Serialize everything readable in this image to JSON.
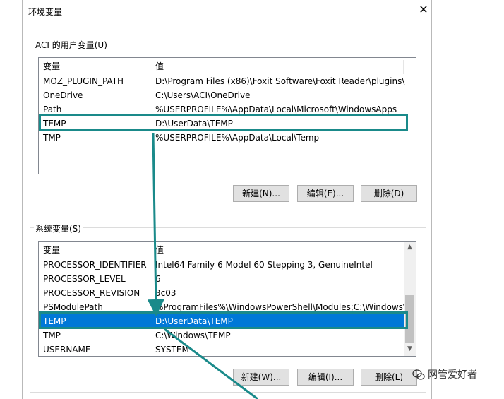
{
  "dialog": {
    "title": "环境变量",
    "close_symbol": "✕"
  },
  "user_vars": {
    "group_label": "ACI 的用户变量(U)",
    "col_variable": "变量",
    "col_value": "值",
    "rows": [
      {
        "name": "MOZ_PLUGIN_PATH",
        "value": "D:\\Program Files (x86)\\Foxit Software\\Foxit Reader\\plugins\\"
      },
      {
        "name": "OneDrive",
        "value": "C:\\Users\\ACI\\OneDrive"
      },
      {
        "name": "Path",
        "value": "%USERPROFILE%\\AppData\\Local\\Microsoft\\WindowsApps"
      },
      {
        "name": "TEMP",
        "value": "D:\\UserData\\TEMP"
      },
      {
        "name": "TMP",
        "value": "%USERPROFILE%\\AppData\\Local\\Temp"
      }
    ],
    "btn_new": "新建(N)...",
    "btn_edit": "编辑(E)...",
    "btn_delete": "删除(D)"
  },
  "system_vars": {
    "group_label": "系统变量(S)",
    "col_variable": "变量",
    "col_value": "值",
    "rows": [
      {
        "name": "PROCESSOR_IDENTIFIER",
        "value": "Intel64 Family 6 Model 60 Stepping 3, GenuineIntel"
      },
      {
        "name": "PROCESSOR_LEVEL",
        "value": "6"
      },
      {
        "name": "PROCESSOR_REVISION",
        "value": "3c03"
      },
      {
        "name": "PSModulePath",
        "value": "%ProgramFiles%\\WindowsPowerShell\\Modules;C:\\Windows\\..."
      },
      {
        "name": "TEMP",
        "value": "D:\\UserData\\TEMP"
      },
      {
        "name": "TMP",
        "value": "C:\\Windows\\TEMP"
      },
      {
        "name": "USERNAME",
        "value": "SYSTEM"
      }
    ],
    "btn_new": "新建(W)...",
    "btn_edit": "编辑(I)...",
    "btn_delete": "删除(L)"
  },
  "watermark": {
    "text": "网管爱好者"
  },
  "colors": {
    "highlight_box": "#1a8a8a",
    "selection": "#0078d7"
  }
}
